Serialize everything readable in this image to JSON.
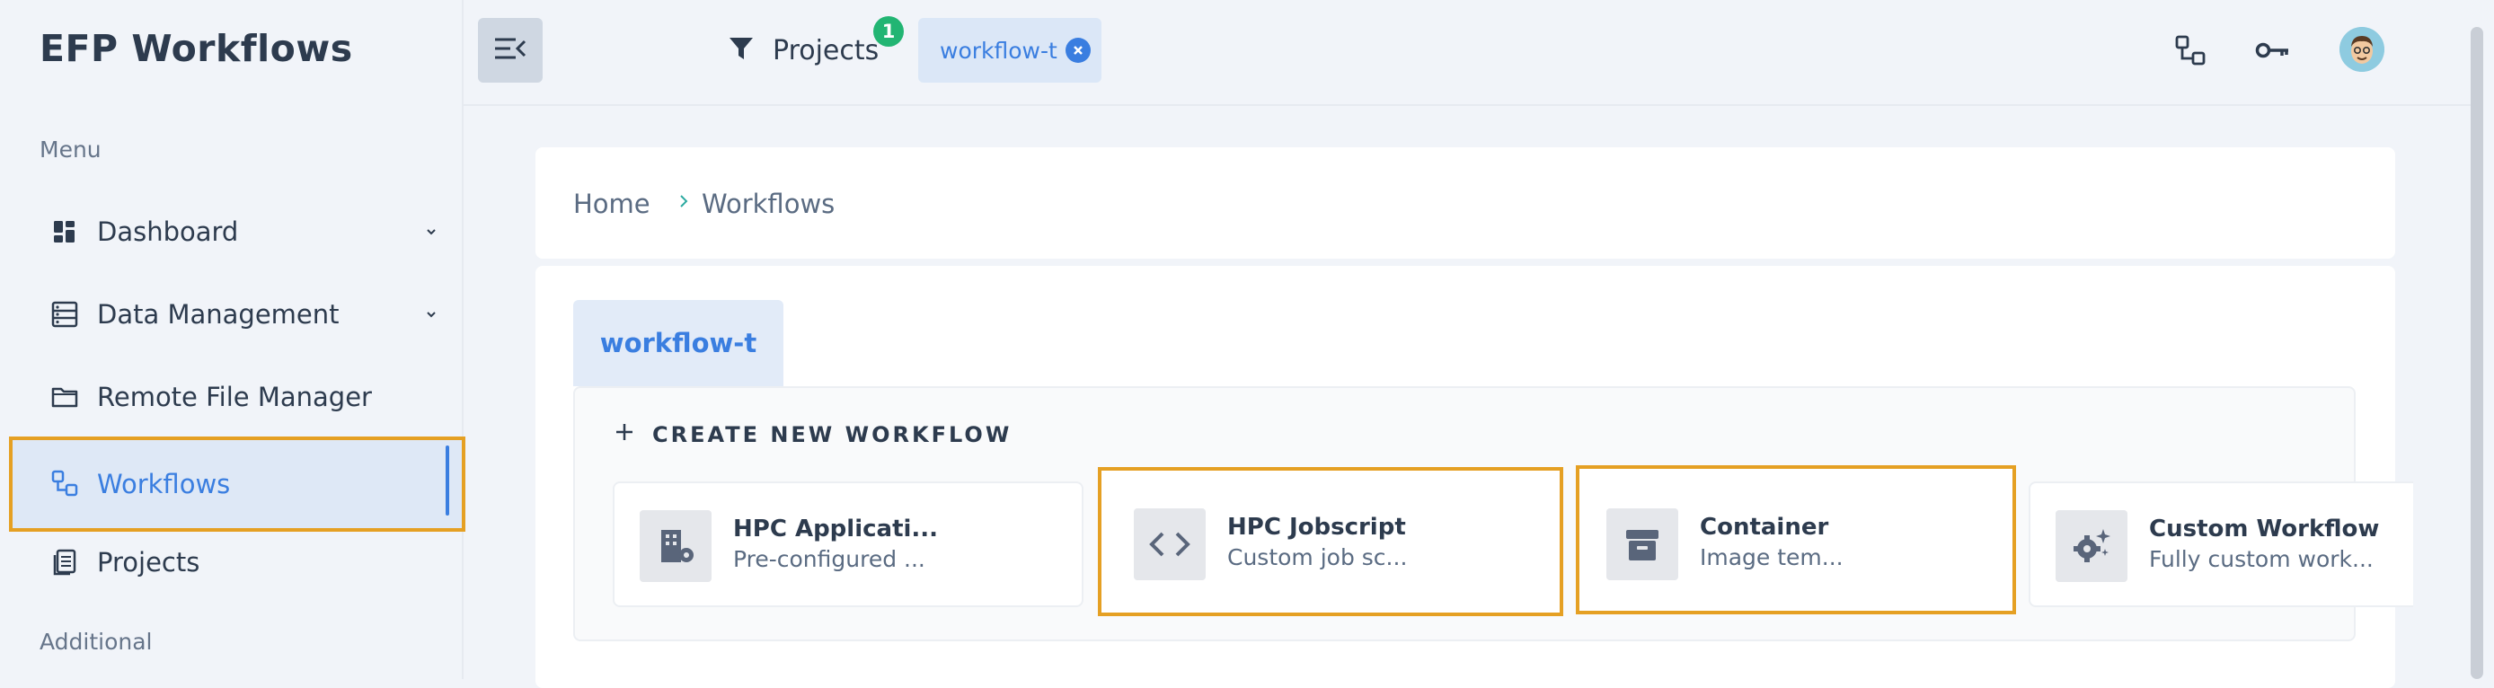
{
  "sidebar": {
    "app_title": "EFP Workflows",
    "menu_label": "Menu",
    "additional_label": "Additional",
    "items": [
      {
        "label": "Dashboard",
        "icon": "dashboard-icon",
        "has_chevron": true
      },
      {
        "label": "Data Management",
        "icon": "storage-icon",
        "has_chevron": true
      },
      {
        "label": "Remote File Manager",
        "icon": "folder-icon",
        "has_chevron": false
      },
      {
        "label": "Workflows",
        "icon": "workflow-icon",
        "active": true
      },
      {
        "label": "Projects",
        "icon": "clipboard-icon",
        "has_chevron": false
      }
    ]
  },
  "topbar": {
    "filter_label": "Projects",
    "filter_count": "1",
    "chip_label": "workflow-t",
    "icons": [
      "workflow-icon",
      "key-icon",
      "avatar"
    ]
  },
  "breadcrumb": {
    "home": "Home",
    "current": "Workflows"
  },
  "main": {
    "tab_label": "workflow-t",
    "create_heading": "CREATE NEW WORKFLOW",
    "cards": [
      {
        "title": "HPC Applicati...",
        "desc": "Pre-configured ...",
        "icon": "building-gear-icon"
      },
      {
        "title": "HPC Jobscript",
        "desc": "Custom job sc...",
        "icon": "code-icon"
      },
      {
        "title": "Container",
        "desc": "Image tem...",
        "icon": "archive-icon"
      },
      {
        "title": "Custom Workflow",
        "desc": "Fully custom work...",
        "icon": "gears-icon"
      }
    ]
  },
  "colors": {
    "accent": "#3a7ee0",
    "highlight": "#e5a023",
    "badge": "#22b573",
    "text": "#2d3b4e"
  }
}
